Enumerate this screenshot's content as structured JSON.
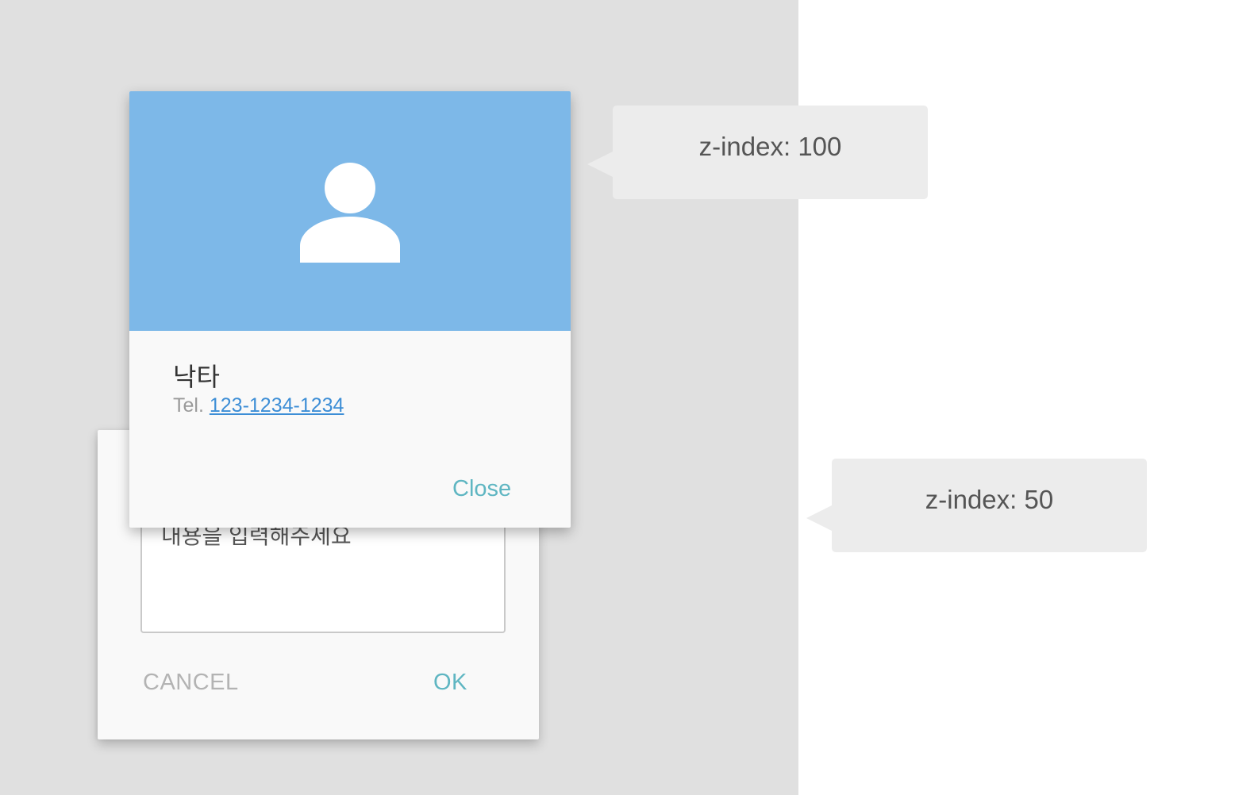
{
  "dialog_back": {
    "textarea_text": "내용을 입력해주세요",
    "cancel_label": "CANCEL",
    "ok_label": "OK"
  },
  "dialog_front": {
    "avatar_icon": "person-icon",
    "name": "낙타",
    "tel_prefix": "Tel.",
    "tel_number": "123-1234-1234",
    "close_label": "Close"
  },
  "callouts": {
    "top": "z-index: 100",
    "bottom": "z-index: 50"
  },
  "colors": {
    "header": "#7db8e8",
    "accent": "#5fb6c2",
    "link": "#3d8ed6",
    "backdrop": "#e0e0e0"
  }
}
